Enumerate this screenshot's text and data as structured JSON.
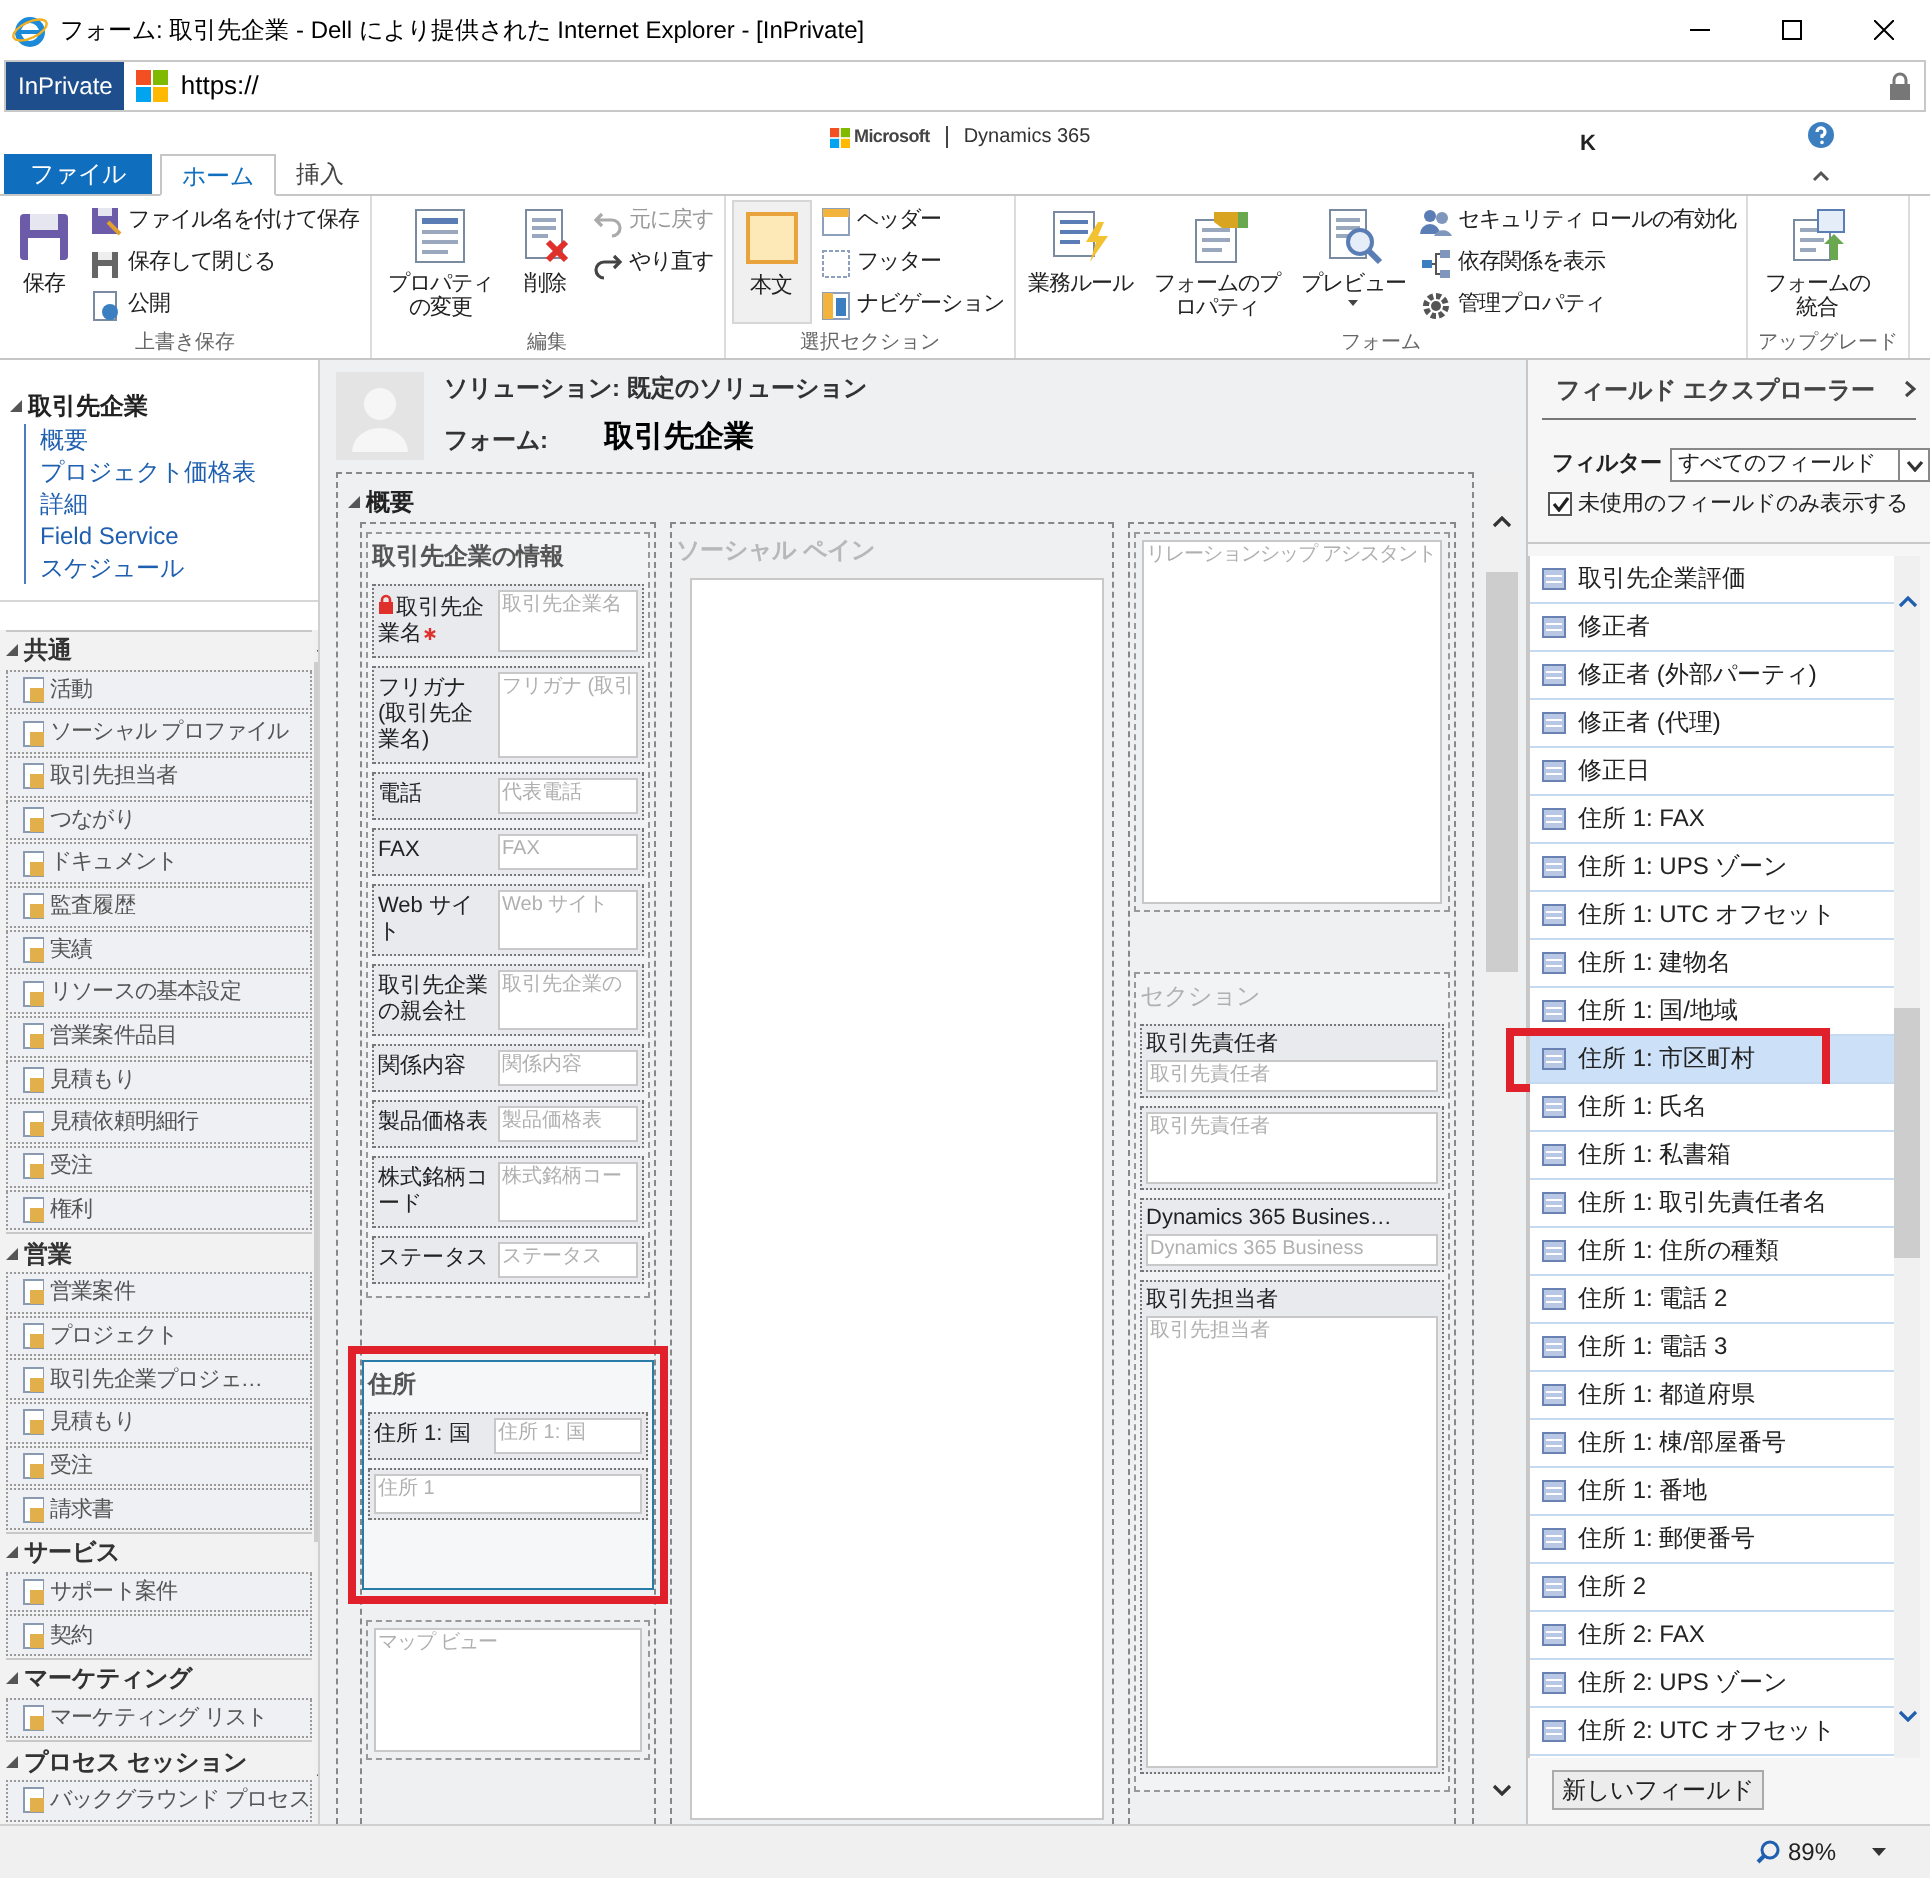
{
  "window": {
    "title": "フォーム: 取引先企業 - Dell により提供された Internet Explorer - [InPrivate]"
  },
  "address_bar": {
    "badge": "InPrivate",
    "url": "https://"
  },
  "brand": {
    "company": "Microsoft",
    "product": "Dynamics 365",
    "user": "K"
  },
  "ribbon_tabs": [
    {
      "label": "ファイル",
      "kind": "file",
      "selected": false
    },
    {
      "label": "ホーム",
      "kind": "tab",
      "selected": true
    },
    {
      "label": "挿入",
      "kind": "tab",
      "selected": false
    }
  ],
  "ribbon_groups": [
    {
      "label": "上書き保存",
      "buttons": [
        {
          "label": "保存",
          "kind": "large",
          "selected": false,
          "disabled": false
        },
        {
          "label": "ファイル名を付けて保存",
          "kind": "small",
          "selected": false,
          "disabled": false
        },
        {
          "label": "保存して閉じる",
          "kind": "small",
          "selected": false,
          "disabled": false
        },
        {
          "label": "公開",
          "kind": "small",
          "selected": false,
          "disabled": false
        }
      ]
    },
    {
      "label": "編集",
      "buttons": [
        {
          "label": "プロパティの変更",
          "kind": "large",
          "selected": false,
          "disabled": false
        },
        {
          "label": "削除",
          "kind": "large",
          "selected": false,
          "disabled": false
        },
        {
          "label": "元に戻す",
          "kind": "small",
          "selected": false,
          "disabled": true
        },
        {
          "label": "やり直す",
          "kind": "small",
          "selected": false,
          "disabled": false
        }
      ]
    },
    {
      "label": "選択セクション",
      "buttons": [
        {
          "label": "本文",
          "kind": "large",
          "selected": true,
          "disabled": false
        },
        {
          "label": "ヘッダー",
          "kind": "small",
          "selected": false,
          "disabled": false
        },
        {
          "label": "フッター",
          "kind": "small",
          "selected": false,
          "disabled": false
        },
        {
          "label": "ナビゲーション",
          "kind": "small",
          "selected": false,
          "disabled": false
        }
      ]
    },
    {
      "label": "フォーム",
      "buttons": [
        {
          "label": "業務ルール",
          "kind": "large",
          "selected": false,
          "disabled": false
        },
        {
          "label": "フォームのプロパティ",
          "kind": "large",
          "selected": false,
          "disabled": false
        },
        {
          "label": "プレビュー",
          "kind": "large",
          "selected": false,
          "disabled": false,
          "dropdown": true
        },
        {
          "label": "セキュリティ ロールの有効化",
          "kind": "small",
          "selected": false,
          "disabled": false
        },
        {
          "label": "依存関係を表示",
          "kind": "small",
          "selected": false,
          "disabled": false
        },
        {
          "label": "管理プロパティ",
          "kind": "small",
          "selected": false,
          "disabled": false
        }
      ]
    },
    {
      "label": "アップグレード",
      "buttons": [
        {
          "label": "フォームの統合",
          "kind": "large",
          "selected": false,
          "disabled": false
        }
      ]
    }
  ],
  "nav_tree": {
    "label": "取引先企業",
    "expanded": true,
    "children": [
      {
        "label": "概要"
      },
      {
        "label": "プロジェクト価格表"
      },
      {
        "label": "詳細"
      },
      {
        "label": "Field Service"
      },
      {
        "label": "スケジュール"
      }
    ]
  },
  "nav_groups": [
    {
      "label": "共通",
      "expanded": true,
      "items": [
        "活動",
        "ソーシャル プロファイル",
        "取引先担当者",
        "つながり",
        "ドキュメント",
        "監査履歴",
        "実績",
        "リソースの基本設定",
        "営業案件品目",
        "見積もり",
        "見積依頼明細行",
        "受注",
        "権利"
      ]
    },
    {
      "label": "営業",
      "expanded": true,
      "items": [
        "営業案件",
        "プロジェクト",
        "取引先企業プロジェ…",
        "見積もり",
        "受注",
        "請求書"
      ]
    },
    {
      "label": "サービス",
      "expanded": true,
      "items": [
        "サポート案件",
        "契約"
      ]
    },
    {
      "label": "マーケティング",
      "expanded": true,
      "items": [
        "マーケティング リスト"
      ]
    },
    {
      "label": "プロセス セッション",
      "expanded": true,
      "items": [
        "バックグラウンド プロセス"
      ]
    }
  ],
  "form_header": {
    "solution": "ソリューション: 既定のソリューション",
    "form_label": "フォーム:",
    "form_name": "取引先企業"
  },
  "tab": {
    "label": "概要",
    "expanded": true,
    "columns": [
      [
        {
          "kind": "section",
          "title": "取引先企業の情報",
          "muted": false,
          "highlighted": false,
          "fields": [
            {
              "kind": "inline",
              "label": "取引先企業名",
              "placeholder": "取引先企業名",
              "required": true
            },
            {
              "kind": "inline",
              "label": "フリガナ (取引先企業名)",
              "placeholder": "フリガナ (取引",
              "required": false
            },
            {
              "kind": "inline",
              "label": "電話",
              "placeholder": "代表電話",
              "required": false
            },
            {
              "kind": "inline",
              "label": "FAX",
              "placeholder": "FAX",
              "required": false
            },
            {
              "kind": "inline",
              "label": "Web サイト",
              "placeholder": "Web サイト",
              "required": false
            },
            {
              "kind": "inline",
              "label": "取引先企業の親会社",
              "placeholder": "取引先企業の",
              "required": false
            },
            {
              "kind": "inline",
              "label": "関係内容",
              "placeholder": "関係内容",
              "required": false
            },
            {
              "kind": "inline",
              "label": "製品価格表",
              "placeholder": "製品価格表",
              "required": false
            },
            {
              "kind": "inline",
              "label": "株式銘柄コード",
              "placeholder": "株式銘柄コー",
              "required": false
            },
            {
              "kind": "inline",
              "label": "ステータス",
              "placeholder": "ステータス",
              "required": false
            }
          ]
        },
        {
          "kind": "section",
          "title": "住所",
          "muted": false,
          "highlighted": true,
          "fields": [
            {
              "kind": "inline",
              "label": "住所 1: 国",
              "placeholder": "住所 1: 国",
              "required": false
            },
            {
              "kind": "input",
              "placeholder": "住所 1"
            }
          ]
        },
        {
          "kind": "control",
          "placeholder": "マップ ビュー"
        }
      ],
      [
        {
          "kind": "pane",
          "title": "ソーシャル ペイン"
        }
      ],
      [
        {
          "kind": "control",
          "placeholder": "リレーションシップ アシスタント"
        },
        {
          "kind": "section",
          "title": "セクション",
          "muted": true,
          "highlighted": false,
          "fields": [
            {
              "kind": "stacked",
              "label": "取引先責任者",
              "placeholder": "取引先責任者"
            },
            {
              "kind": "box",
              "placeholder": "取引先責任者"
            },
            {
              "kind": "stacked",
              "label": "Dynamics 365 Busines…",
              "placeholder": "Dynamics 365 Business"
            },
            {
              "kind": "tall",
              "label": "取引先担当者",
              "placeholder": "取引先担当者"
            }
          ]
        }
      ]
    ]
  },
  "field_explorer": {
    "title": "フィールド エクスプローラー",
    "filter_label": "フィルター",
    "filter_value": "すべてのフィールド",
    "unused_only": {
      "label": "未使用のフィールドのみ表示する",
      "checked": true
    },
    "fields": [
      {
        "label": "取引先企業評価",
        "selected": false,
        "highlighted": false
      },
      {
        "label": "修正者",
        "selected": false,
        "highlighted": false
      },
      {
        "label": "修正者 (外部パーティ)",
        "selected": false,
        "highlighted": false
      },
      {
        "label": "修正者 (代理)",
        "selected": false,
        "highlighted": false
      },
      {
        "label": "修正日",
        "selected": false,
        "highlighted": false
      },
      {
        "label": "住所 1: FAX",
        "selected": false,
        "highlighted": false
      },
      {
        "label": "住所 1: UPS ゾーン",
        "selected": false,
        "highlighted": false
      },
      {
        "label": "住所 1: UTC オフセット",
        "selected": false,
        "highlighted": false
      },
      {
        "label": "住所 1: 建物名",
        "selected": false,
        "highlighted": false
      },
      {
        "label": "住所 1: 国/地域",
        "selected": false,
        "highlighted": false
      },
      {
        "label": "住所 1: 市区町村",
        "selected": true,
        "highlighted": true
      },
      {
        "label": "住所 1: 氏名",
        "selected": false,
        "highlighted": false
      },
      {
        "label": "住所 1: 私書箱",
        "selected": false,
        "highlighted": false
      },
      {
        "label": "住所 1: 取引先責任者名",
        "selected": false,
        "highlighted": false
      },
      {
        "label": "住所 1: 住所の種類",
        "selected": false,
        "highlighted": false
      },
      {
        "label": "住所 1: 電話 2",
        "selected": false,
        "highlighted": false
      },
      {
        "label": "住所 1: 電話 3",
        "selected": false,
        "highlighted": false
      },
      {
        "label": "住所 1: 都道府県",
        "selected": false,
        "highlighted": false
      },
      {
        "label": "住所 1: 棟/部屋番号",
        "selected": false,
        "highlighted": false
      },
      {
        "label": "住所 1: 番地",
        "selected": false,
        "highlighted": false
      },
      {
        "label": "住所 1: 郵便番号",
        "selected": false,
        "highlighted": false
      },
      {
        "label": "住所 2",
        "selected": false,
        "highlighted": false
      },
      {
        "label": "住所 2: FAX",
        "selected": false,
        "highlighted": false
      },
      {
        "label": "住所 2: UPS ゾーン",
        "selected": false,
        "highlighted": false
      },
      {
        "label": "住所 2: UTC オフセット",
        "selected": false,
        "highlighted": false
      }
    ],
    "new_field_button": "新しいフィールド"
  },
  "status_bar": {
    "zoom": "89%"
  }
}
